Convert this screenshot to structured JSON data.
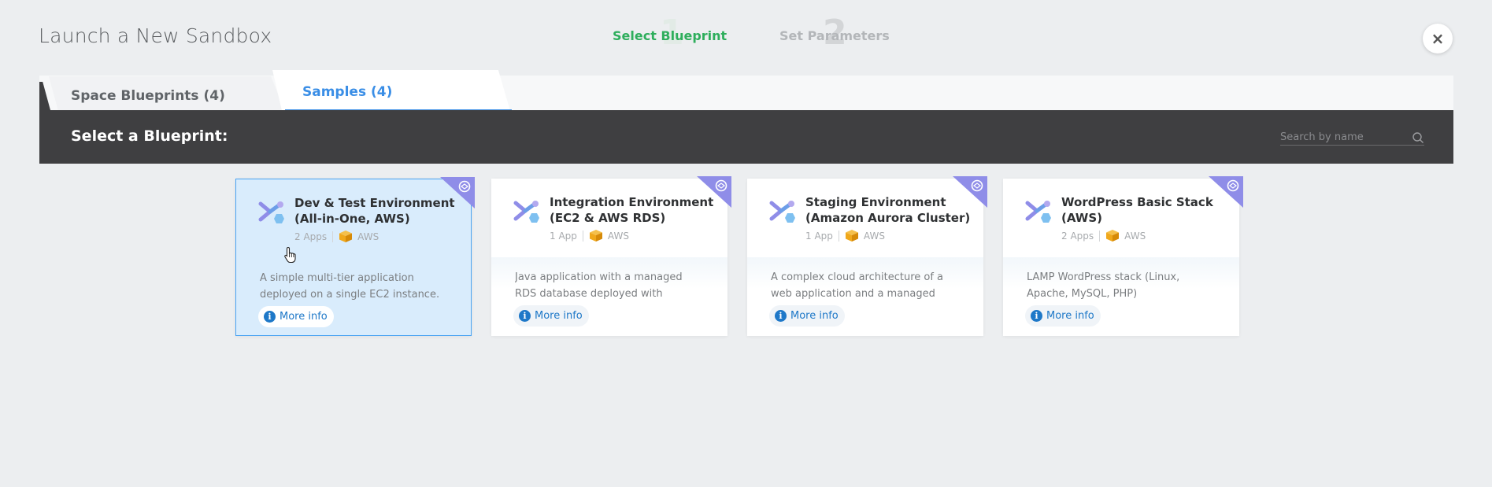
{
  "window": {
    "title": "Launch a New Sandbox",
    "close_icon": "×"
  },
  "steps": [
    {
      "number": "1",
      "label": "Select Blueprint",
      "state": "active",
      "color": "#2eae5c"
    },
    {
      "number": "2",
      "label": "Set Parameters",
      "state": "inactive",
      "color": "#b3b6b9"
    }
  ],
  "tabs": [
    {
      "label": "Space Blueprints (4)",
      "active": false
    },
    {
      "label": "Samples (4)",
      "active": true
    }
  ],
  "header": {
    "label": "Select a Blueprint:"
  },
  "search": {
    "placeholder": "Search by name",
    "value": ""
  },
  "cards": [
    {
      "title": "Dev & Test Environment (All-in-One, AWS)",
      "apps": "2 Apps",
      "provider": "AWS",
      "description": "A simple multi-tier application deployed on a single EC2 instance.",
      "more_info": "More info",
      "selected": true
    },
    {
      "title": "Integration Environment (EC2 & AWS RDS)",
      "apps": "1 App",
      "provider": "AWS",
      "description": "Java application with a managed RDS database deployed with TerraForm.",
      "more_info": "More info",
      "selected": false
    },
    {
      "title": "Staging Environment (Amazon Aurora Cluster)",
      "apps": "1 App",
      "provider": "AWS",
      "description": "A complex cloud architecture of a web application and a managed",
      "more_info": "More info",
      "selected": false
    },
    {
      "title": "WordPress Basic Stack (AWS)",
      "apps": "2 Apps",
      "provider": "AWS",
      "description": "LAMP WordPress stack (Linux, Apache, MySQL, PHP)",
      "more_info": "More info",
      "selected": false
    }
  ],
  "colors": {
    "accent": "#3a8ee6",
    "success": "#2eae5c",
    "dark_bar": "#3f3f41",
    "corner_badge": "#8f8de8",
    "aws_orange": "#f0a81b"
  },
  "icons": {
    "blueprint_logo": "blueprint-logo-icon",
    "sample_badge": "sample-badge-icon",
    "aws": "aws-cube-icon",
    "info": "info-icon",
    "search": "search-icon"
  }
}
